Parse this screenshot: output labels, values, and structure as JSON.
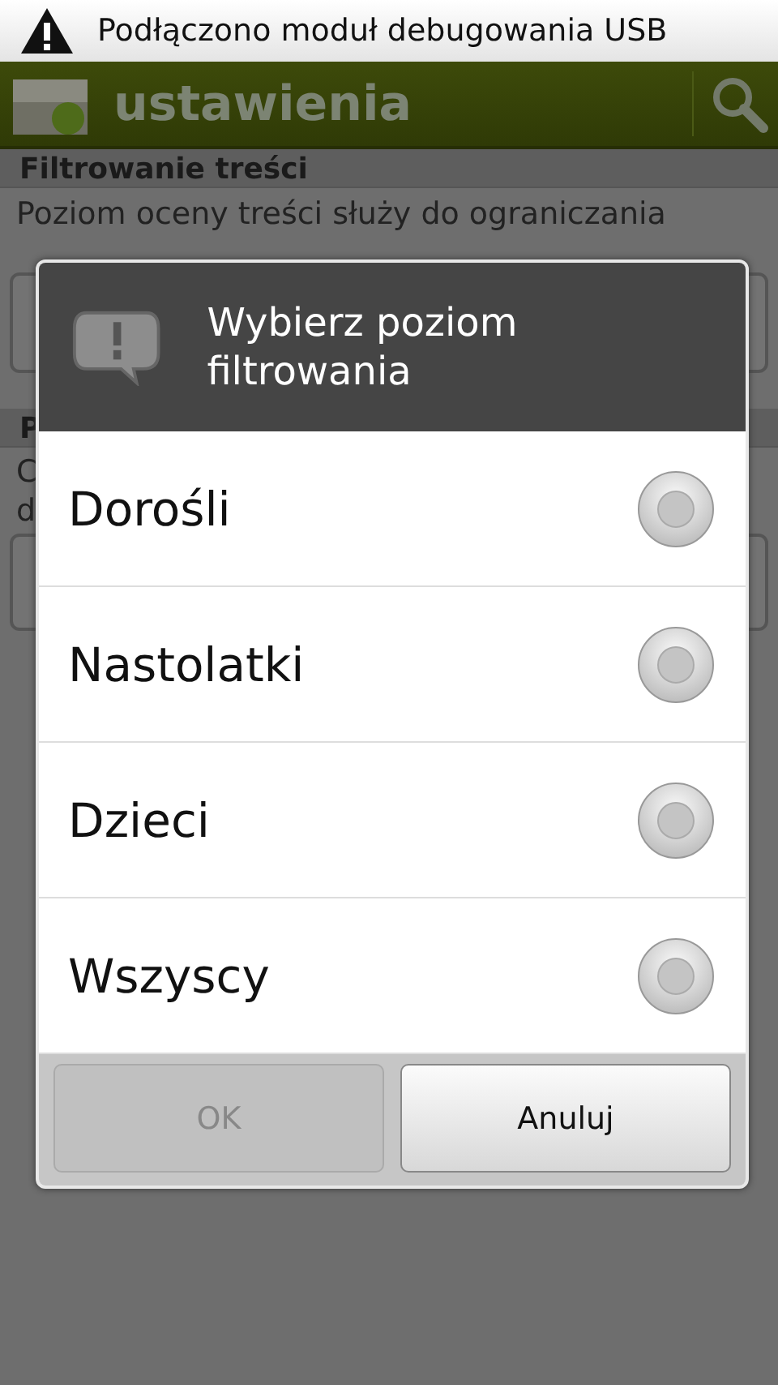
{
  "status_bar": {
    "notification": "Podłączono moduł debugowania USB"
  },
  "action_bar": {
    "title": "ustawienia"
  },
  "background": {
    "section_1": {
      "header": "Filtrowanie treści",
      "description": "Poziom oceny treści służy do ograniczania"
    },
    "section_2": {
      "header": "P",
      "description_lines": [
        "C",
        "d"
      ]
    }
  },
  "dialog": {
    "title": "Wybierz poziom filtrowania",
    "options": [
      {
        "label": "Dorośli",
        "selected": false
      },
      {
        "label": "Nastolatki",
        "selected": false
      },
      {
        "label": "Dzieci",
        "selected": false
      },
      {
        "label": "Wszyscy",
        "selected": false
      }
    ],
    "buttons": [
      {
        "label": "OK",
        "disabled": true
      },
      {
        "label": "Anuluj",
        "disabled": false
      }
    ]
  }
}
